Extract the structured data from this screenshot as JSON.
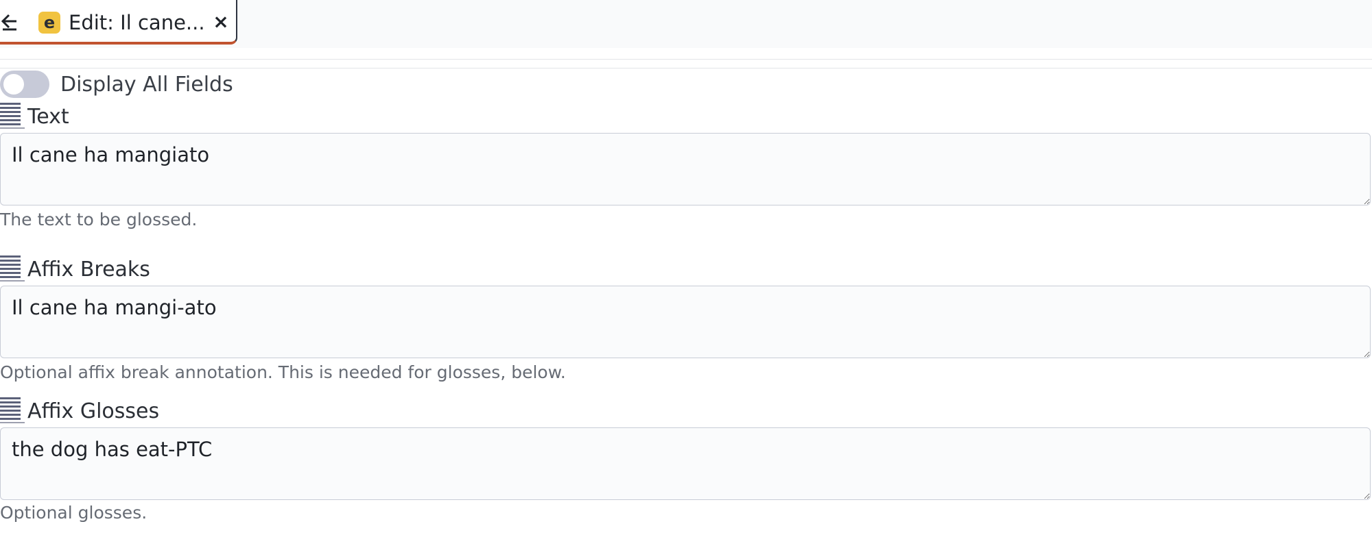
{
  "tab": {
    "title": "Edit: Il cane...",
    "badge_letter": "e",
    "close_glyph": "×",
    "icons": {
      "back": "arrow-left-icon",
      "close": "close-icon",
      "app": "app-badge-icon"
    }
  },
  "toggle": {
    "label": "Display All Fields",
    "checked": false
  },
  "fields": [
    {
      "label": "Text",
      "value": "Il cane ha mangiato",
      "help": "The text to be glossed.",
      "icon": "text-lines-icon"
    },
    {
      "label": "Affix Breaks",
      "value": "Il cane ha mangi-ato",
      "help": "Optional affix break annotation. This is needed for glosses, below.",
      "icon": "text-lines-icon"
    },
    {
      "label": "Affix Glosses",
      "value": "the dog has eat-PTC",
      "help": "Optional glosses.",
      "icon": "text-lines-icon"
    }
  ],
  "colors": {
    "accent_underline": "#c1532f",
    "badge": "#f1c340",
    "toggle_off": "#c7cad8",
    "icon": "#5b6179",
    "help_text": "#666b74"
  }
}
